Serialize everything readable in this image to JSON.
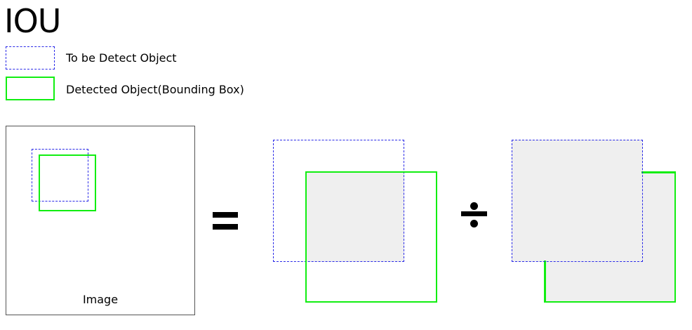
{
  "title": "IOU",
  "legend": {
    "ground_truth_label": "To be Detect Object",
    "detected_label": "Detected Object(Bounding Box)"
  },
  "panel": {
    "label": "Image"
  },
  "operators": {
    "equals": "equals-icon",
    "divide": "divide-icon"
  },
  "colors": {
    "ground_truth": "#2a2ae8",
    "detected": "#11ee11",
    "fill": "#efefef"
  }
}
